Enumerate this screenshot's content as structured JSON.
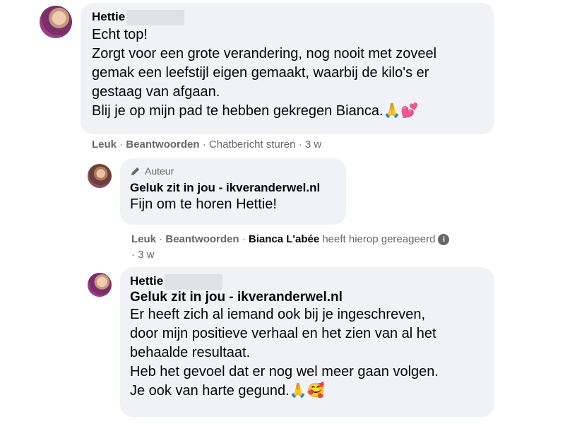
{
  "comment1": {
    "author": "Hettie",
    "lines": [
      "Echt top!",
      "Zorgt voor een grote verandering, nog nooit met zoveel",
      "gemak een leefstijl eigen gemaakt, waarbij de kilo's er",
      "gestaag van afgaan.",
      "Blij je op mijn pad te hebben gekregen Bianca.🙏💕"
    ],
    "actions": {
      "like": "Leuk",
      "reply": "Beantwoorden",
      "chat": "Chatbericht sturen",
      "time": "3 w"
    }
  },
  "reply1": {
    "badge": "Auteur",
    "author": "Geluk zit in jou - ikveranderwel.nl",
    "text": "Fijn om te horen Hettie!",
    "actions": {
      "like": "Leuk",
      "reply": "Beantwoorden",
      "reactor": "Bianca L'abée",
      "reacted_text": "heeft hierop gereageerd",
      "time": "3 w"
    }
  },
  "reply2": {
    "author": "Hettie",
    "mention": "Geluk zit in jou - ikveranderwel.nl",
    "lines": [
      "Er heeft zich al iemand ook bij je ingeschreven,",
      "door mijn positieve verhaal en het zien van al het",
      "behaalde resultaat.",
      "Heb het gevoel dat er nog wel meer gaan volgen.",
      "Je ook van harte gegund.🙏🥰"
    ]
  },
  "colors": {
    "bubble": "#f0f2f5",
    "meta": "#65676b",
    "text": "#050505"
  }
}
